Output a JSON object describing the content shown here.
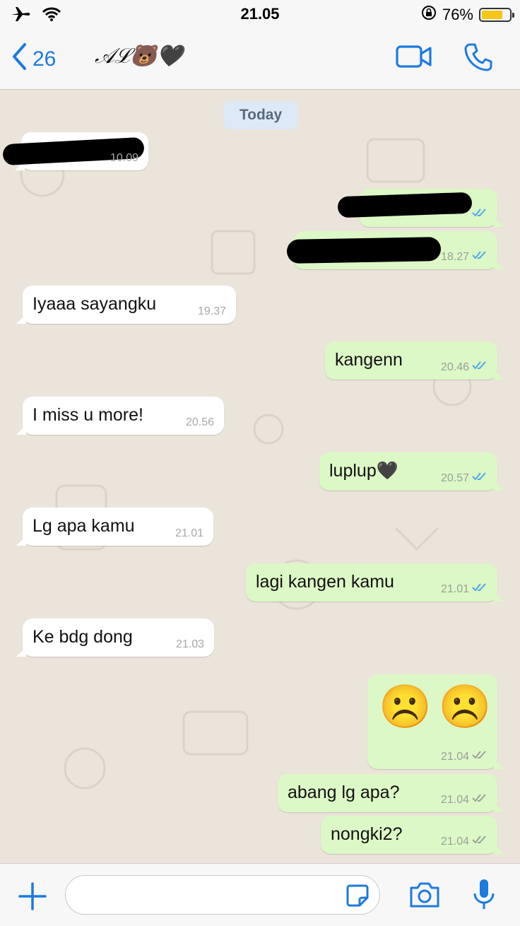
{
  "status_bar": {
    "time": "21.05",
    "battery_percent": "76%",
    "battery_level": 0.76
  },
  "nav": {
    "back_count": "26",
    "contact_name": "𝒜ℒ🐻🖤"
  },
  "date_divider": "Today",
  "messages": [
    {
      "dir": "in",
      "text": "",
      "time": "10.09",
      "redacted": true
    },
    {
      "dir": "out",
      "text": "",
      "time": "",
      "redacted": true
    },
    {
      "dir": "out",
      "text": "",
      "time": "18.27",
      "redacted": true
    },
    {
      "dir": "in",
      "text": "Iyaaa sayangku",
      "time": "19.37"
    },
    {
      "dir": "out",
      "text": "kangenn",
      "time": "20.46",
      "read": true
    },
    {
      "dir": "in",
      "text": "I miss u more!",
      "time": "20.56"
    },
    {
      "dir": "out",
      "text": "luplup🖤",
      "time": "20.57",
      "read": true
    },
    {
      "dir": "in",
      "text": "Lg apa kamu",
      "time": "21.01"
    },
    {
      "dir": "out",
      "text": "lagi kangen kamu",
      "time": "21.01",
      "read": true
    },
    {
      "dir": "in",
      "text": "Ke bdg dong",
      "time": "21.03"
    },
    {
      "dir": "out",
      "text": "☹️☹️",
      "time": "21.04",
      "read": false
    },
    {
      "dir": "out",
      "text": "abang lg apa?",
      "time": "21.04",
      "read": false
    },
    {
      "dir": "out",
      "text": "nongki2?",
      "time": "21.04",
      "read": false
    }
  ],
  "colors": {
    "accent": "#1d7ae0",
    "outgoing_bubble": "#dcf8c6",
    "incoming_bubble": "#ffffff",
    "chat_bg": "#ebe4da",
    "read_ticks": "#4fa9e8",
    "sent_ticks": "#9aa09a"
  },
  "icons": [
    "airplane-icon",
    "wifi-icon",
    "rotation-lock-icon",
    "battery-icon",
    "chevron-left-icon",
    "video-call-icon",
    "phone-icon",
    "plus-icon",
    "sticker-icon",
    "camera-icon",
    "microphone-icon"
  ]
}
